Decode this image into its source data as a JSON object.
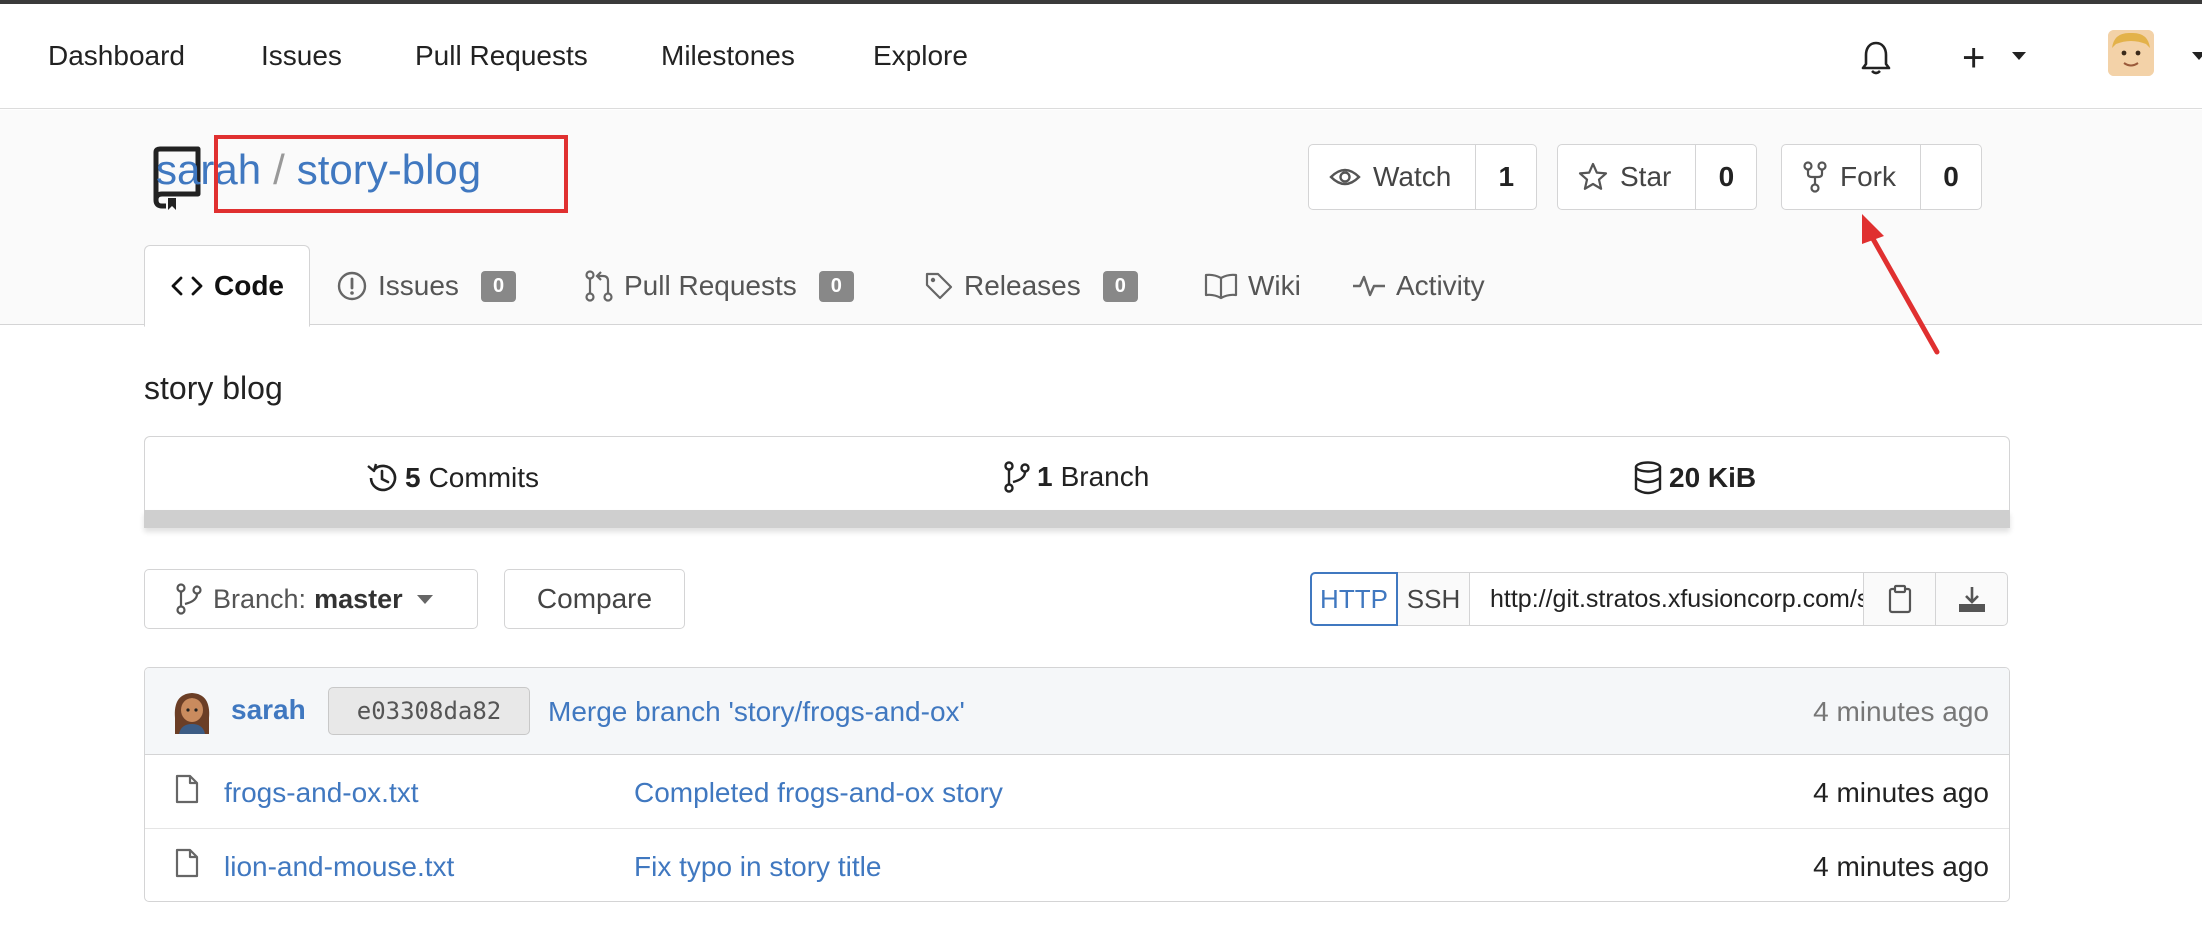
{
  "topnav": {
    "items": [
      "Dashboard",
      "Issues",
      "Pull Requests",
      "Milestones",
      "Explore"
    ],
    "icons": [
      "bell-icon",
      "plus-icon",
      "avatar"
    ]
  },
  "repo": {
    "owner": "sarah",
    "separator": "/",
    "name": "story-blog",
    "description": "story blog"
  },
  "actions": {
    "watch": {
      "label": "Watch",
      "count": "1"
    },
    "star": {
      "label": "Star",
      "count": "0"
    },
    "fork": {
      "label": "Fork",
      "count": "0"
    }
  },
  "tabs": {
    "code": "Code",
    "issues": {
      "label": "Issues",
      "count": "0"
    },
    "pulls": {
      "label": "Pull Requests",
      "count": "0"
    },
    "releases": {
      "label": "Releases",
      "count": "0"
    },
    "wiki": "Wiki",
    "activity": "Activity"
  },
  "stats": {
    "commits": {
      "count": "5",
      "label": "Commits"
    },
    "branches": {
      "count": "1",
      "label": "Branch"
    },
    "size": "20 KiB"
  },
  "branch": {
    "prefix": "Branch:",
    "name": "master"
  },
  "compare": "Compare",
  "clone": {
    "http": "HTTP",
    "ssh": "SSH",
    "url": "http://git.stratos.xfusioncorp.com/sarah/story-blog.git"
  },
  "latest_commit": {
    "author": "sarah",
    "sha": "e03308da82",
    "message": "Merge branch 'story/frogs-and-ox'",
    "time": "4 minutes ago"
  },
  "files": [
    {
      "name": "frogs-and-ox.txt",
      "message": "Completed frogs-and-ox story",
      "time": "4 minutes ago"
    },
    {
      "name": "lion-and-mouse.txt",
      "message": "Fix typo in story title",
      "time": "4 minutes ago"
    }
  ],
  "colors": {
    "link": "#4078c0",
    "annotation": "#e03030",
    "badge": "#888888"
  }
}
